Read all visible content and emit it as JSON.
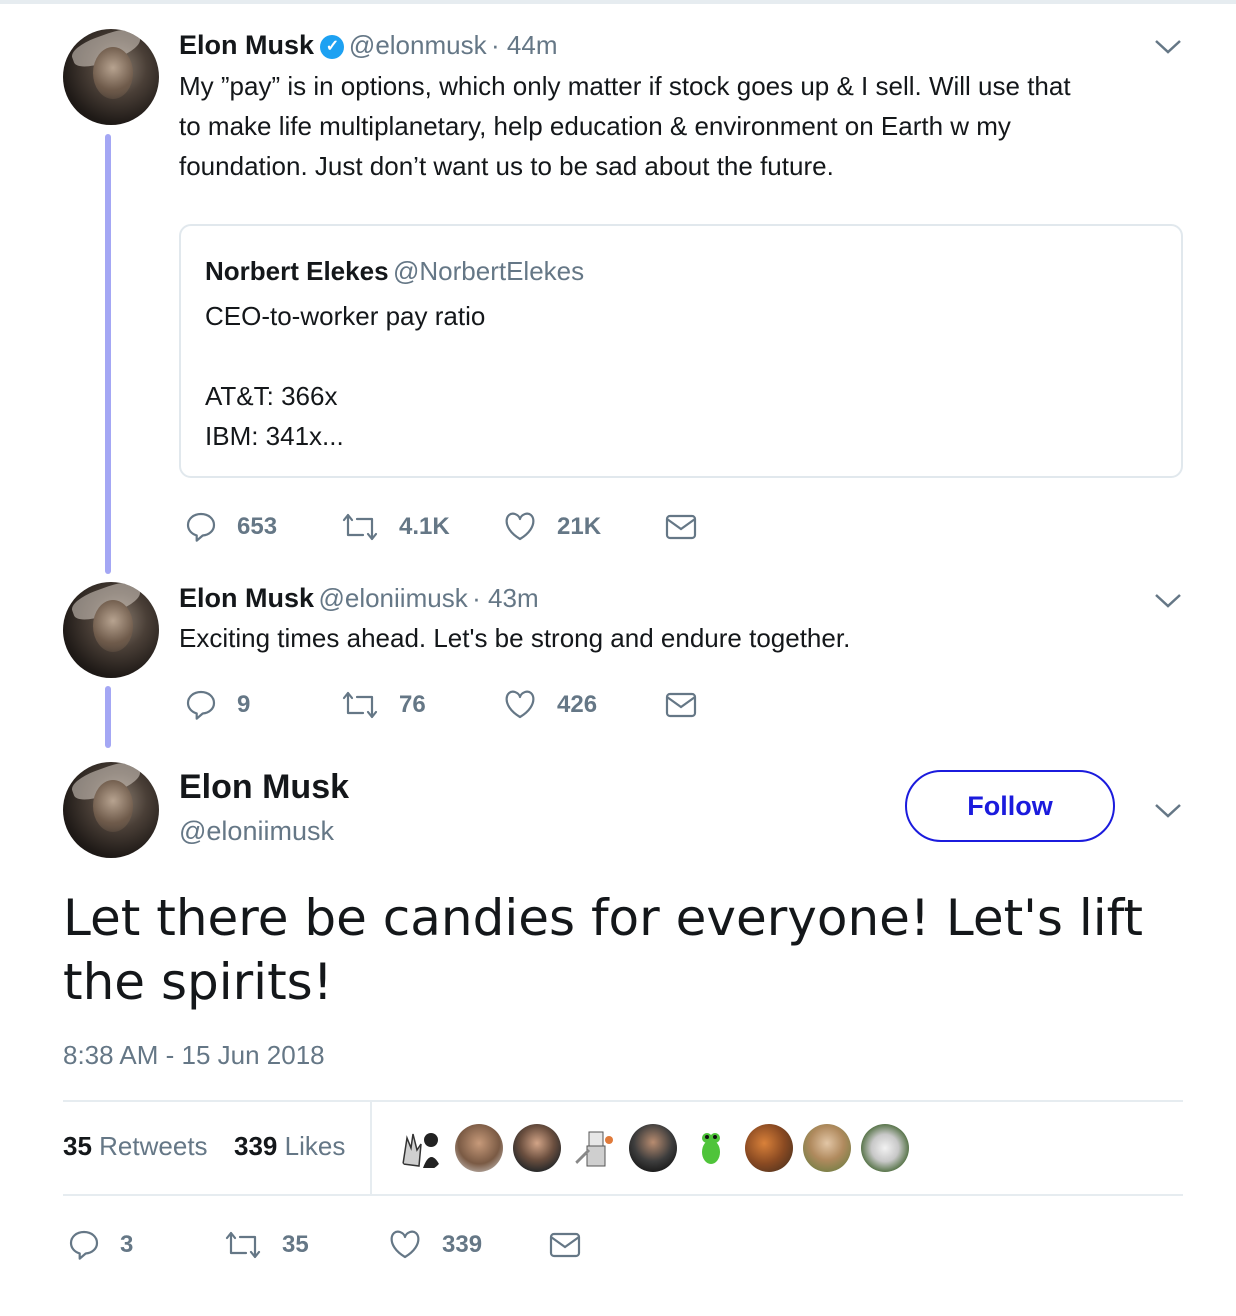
{
  "tweet1": {
    "name": "Elon Musk",
    "handle": "@elonmusk",
    "time": "· 44m",
    "text_lines": [
      "My ”pay” is in options, which only matter if stock goes up & I sell. Will use that",
      "to make life multiplanetary, help education & environment on Earth w my",
      "foundation. Just don’t want us to be sad about the future."
    ],
    "quote": {
      "name": "Norbert Elekes",
      "handle": "@NorbertElekes",
      "line1": "CEO-to-worker pay ratio",
      "line2": "AT&T: 366x",
      "line3": "IBM: 341x..."
    },
    "replies": "653",
    "retweets": "4.1K",
    "likes": "21K"
  },
  "tweet2": {
    "name": "Elon Musk",
    "handle": "@eloniimusk",
    "time": "· 43m",
    "text": "Exciting times ahead. Let's be strong and endure together.",
    "replies": "9",
    "retweets": "76",
    "likes": "426"
  },
  "main": {
    "name": "Elon Musk",
    "handle": "@eloniimusk",
    "follow_label": "Follow",
    "text": "Let there be candies for everyone! Let's lift the spirits!",
    "timestamp": "8:38 AM - 15 Jun 2018",
    "retweet_count": "35",
    "retweet_label": "Retweets",
    "like_count": "339",
    "like_label": "Likes",
    "replies": "3",
    "retweets": "35",
    "likes": "339"
  },
  "colors": {
    "thread_line": "#a4a7f4",
    "follow_blue": "#1b1bdd",
    "muted": "#657786",
    "verified": "#1da1f2"
  },
  "icons": [
    "reply-icon",
    "retweet-icon",
    "like-icon",
    "message-icon",
    "chevron-down-icon",
    "verified-badge-icon"
  ]
}
